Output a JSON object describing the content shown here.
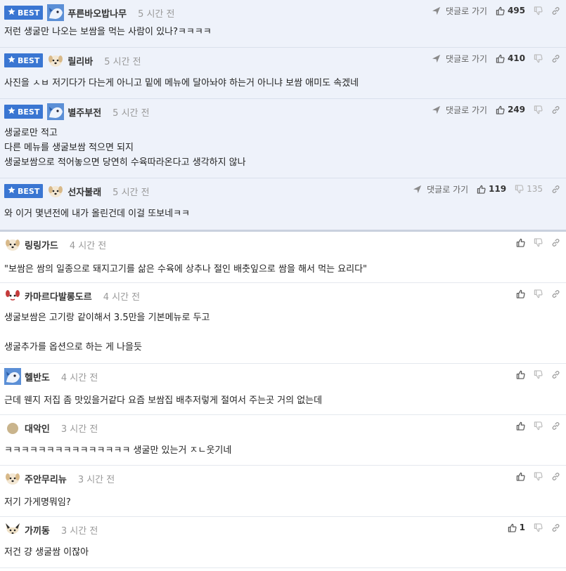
{
  "labels": {
    "best": "BEST",
    "reply": "댓글로 가기"
  },
  "colors": {
    "best_bg": "#eef2fa",
    "badge": "#3a76d2",
    "divider": "#e4e8ee"
  },
  "comments": [
    {
      "best": true,
      "avatar": "bluebird-avatar",
      "nick": "푸른바오밥나무",
      "time": "5 시간 전",
      "up": "495",
      "down": "",
      "lines": [
        "저런 생굴만 나오는 보쌈을 먹는 사람이 있나?ㅋㅋㅋㅋ"
      ]
    },
    {
      "best": true,
      "avatar": "puppy-avatar",
      "nick": "릴리바",
      "time": "5 시간 전",
      "up": "410",
      "down": "",
      "lines": [
        "사진을 ㅅㅂ 저기다가 다는게 아니고 밑에 메뉴에 달아놔야 하는거 아니냐 보쌈 애미도 속겠네"
      ]
    },
    {
      "best": true,
      "avatar": "bluebird-avatar",
      "nick": "별주부전",
      "time": "5 시간 전",
      "up": "249",
      "down": "",
      "lines": [
        "생굴로만 적고",
        "다른 메뉴를 생굴보쌈 적으면 되지",
        "생굴보쌈으로 적어놓으면 당연히 수육따라온다고 생각하지 않나"
      ]
    },
    {
      "best": true,
      "avatar": "puppy-avatar",
      "nick": "선자불래",
      "time": "5 시간 전",
      "up": "119",
      "down": "135",
      "lines": [
        "와 이거 몇년전에 내가 올린건데 이걸 또보네ㅋㅋ"
      ]
    },
    {
      "best": false,
      "avatar": "puppy-avatar",
      "nick": "링링가드",
      "time": "4 시간 전",
      "up": "",
      "down": "",
      "lines": [
        "\"보쌈은 쌈의 일종으로 돼지고기를 삶은 수육에 상추나 절인 배춧잎으로 쌈을 해서 먹는 요리다\""
      ]
    },
    {
      "best": false,
      "avatar": "redpuppy-avatar",
      "nick": "카마르다발롱도르",
      "time": "4 시간 전",
      "up": "",
      "down": "",
      "lines": [
        "생굴보쌈은 고기랑 같이해서 3.5만을 기본메뉴로 두고",
        "",
        "생굴추가를 옵션으로 하는 게 나을듯"
      ]
    },
    {
      "best": false,
      "avatar": "bluebird-avatar",
      "nick": "헬반도",
      "time": "4 시간 전",
      "up": "",
      "down": "",
      "lines": [
        "근데 웬지 저집 좀 맛있을거같다 요즘 보쌈집 배추저렇게 절여서 주는곳 거의 없는데"
      ]
    },
    {
      "best": false,
      "avatar": "egg-avatar",
      "nick": "대악인",
      "time": "3 시간 전",
      "up": "",
      "down": "",
      "lines": [
        "ㅋㅋㅋㅋㅋㅋㅋㅋㅋㅋㅋㅋㅋㅋㅋ 생굴만 있는거 ㅈㄴ웃기네"
      ]
    },
    {
      "best": false,
      "avatar": "puppy-avatar",
      "nick": "주안무리뉴",
      "time": "3 시간 전",
      "up": "",
      "down": "",
      "lines": [
        "저기 가게명뭐임?"
      ]
    },
    {
      "best": false,
      "avatar": "fox-avatar",
      "nick": "가끼동",
      "time": "3 시간 전",
      "up": "1",
      "down": "",
      "lines": [
        "저건 걍 생굴쌈 이잖아"
      ]
    }
  ]
}
